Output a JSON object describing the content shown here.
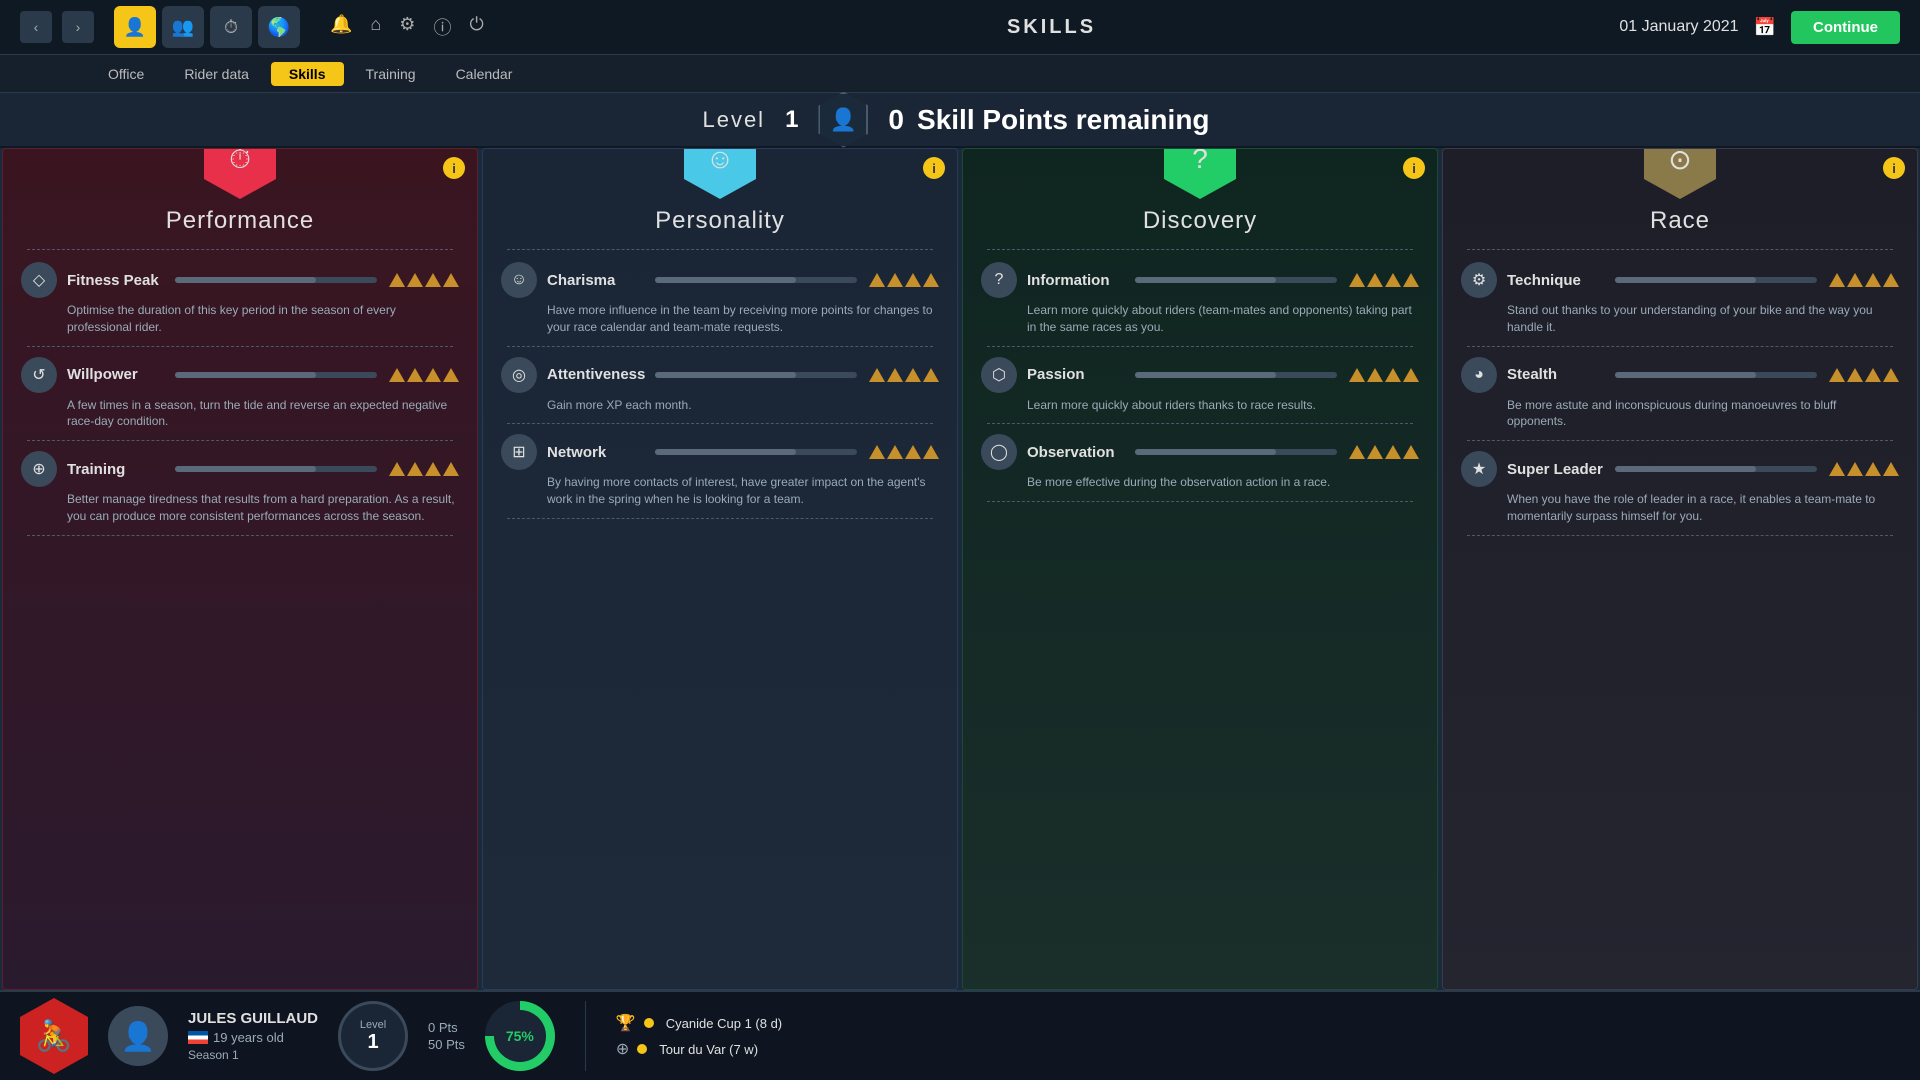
{
  "topbar": {
    "title": "SKILLS",
    "date": "01 January 2021",
    "continue_label": "Continue"
  },
  "subnav": {
    "items": [
      "Office",
      "Rider data",
      "Skills",
      "Training",
      "Calendar"
    ],
    "active": "Skills"
  },
  "level_bar": {
    "level_label": "Level",
    "level_value": "1",
    "skill_points": "0",
    "skill_points_label": "Skill Points remaining"
  },
  "cards": [
    {
      "id": "performance",
      "title": "Performance",
      "icon": "⏱",
      "hex_color": "red",
      "skills": [
        {
          "name": "Fitness Peak",
          "icon": "◇",
          "level": 4,
          "max": 4,
          "desc": "Optimise the duration of this key period in the season of every professional rider."
        },
        {
          "name": "Willpower",
          "icon": "↺",
          "level": 4,
          "max": 4,
          "desc": "A few times in a season, turn the tide and reverse an expected negative race-day condition."
        },
        {
          "name": "Training",
          "icon": "⊕",
          "level": 4,
          "max": 4,
          "desc": "Better manage tiredness that results from a hard preparation. As a result, you can produce more consistent performances across the season."
        }
      ]
    },
    {
      "id": "personality",
      "title": "Personality",
      "icon": "☺",
      "hex_color": "cyan",
      "skills": [
        {
          "name": "Charisma",
          "icon": "☺",
          "level": 4,
          "max": 4,
          "desc": "Have more influence in the team by receiving more points for changes to your race calendar and team-mate requests."
        },
        {
          "name": "Attentiveness",
          "icon": "◎",
          "level": 4,
          "max": 4,
          "desc": "Gain more XP each month."
        },
        {
          "name": "Network",
          "icon": "⊞",
          "level": 4,
          "max": 4,
          "desc": "By having more contacts of interest, have greater impact on the agent's work in the spring when he is looking for a team."
        }
      ]
    },
    {
      "id": "discovery",
      "title": "Discovery",
      "icon": "?",
      "hex_color": "green",
      "skills": [
        {
          "name": "Information",
          "icon": "?",
          "level": 4,
          "max": 4,
          "desc": "Learn more quickly about riders (team-mates and opponents) taking part in the same races as you."
        },
        {
          "name": "Passion",
          "icon": "⬡",
          "level": 4,
          "max": 4,
          "desc": "Learn more quickly about riders thanks to race results."
        },
        {
          "name": "Observation",
          "icon": "◯",
          "level": 4,
          "max": 4,
          "desc": "Be more effective during the observation action in a race."
        }
      ]
    },
    {
      "id": "race",
      "title": "Race",
      "icon": "⊙",
      "hex_color": "gold",
      "skills": [
        {
          "name": "Technique",
          "icon": "⚙",
          "level": 4,
          "max": 4,
          "desc": "Stand out thanks to your understanding of your bike and the way you handle it."
        },
        {
          "name": "Stealth",
          "icon": "◕",
          "level": 4,
          "max": 4,
          "desc": "Be more astute and inconspicuous during manoeuvres to bluff opponents."
        },
        {
          "name": "Super Leader",
          "icon": "★",
          "level": 4,
          "max": 4,
          "desc": "When you have the role of leader in a race, it enables a team-mate to momentarily surpass himself for you."
        }
      ]
    }
  ],
  "bottom": {
    "rider_name": "JULES GUILLAUD",
    "rider_age": "19 years old",
    "rider_season": "Season 1",
    "level_label": "Level",
    "level_value": "1",
    "pts_current": "0 Pts",
    "pts_total": "50 Pts",
    "progress_pct": "75%",
    "races": [
      {
        "icon": "🏆",
        "label": "Cyanide Cup 1 (8 d)"
      },
      {
        "icon": "⊕",
        "label": "Tour du Var (7 w)"
      }
    ]
  }
}
